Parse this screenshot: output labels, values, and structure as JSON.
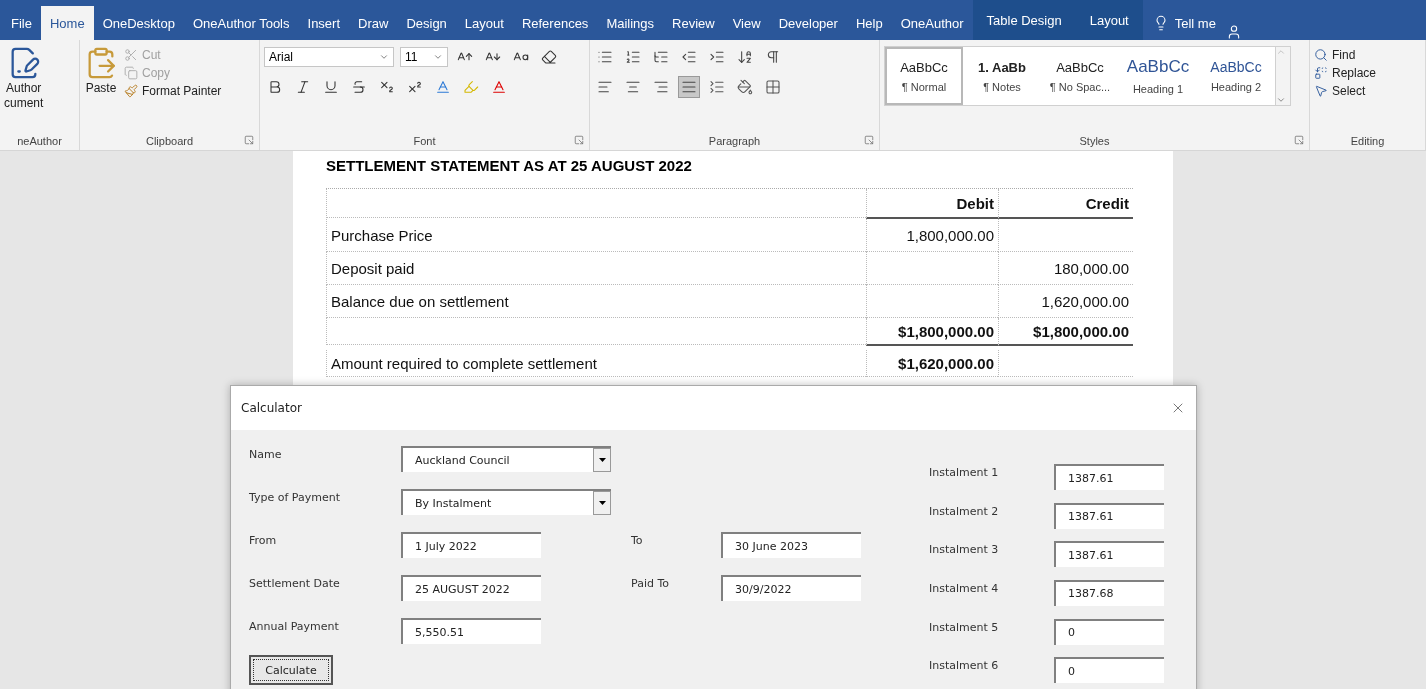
{
  "ribbon_tabs": [
    {
      "label": "File",
      "selected": false,
      "kind": "normal"
    },
    {
      "label": "Home",
      "selected": true,
      "kind": "normal"
    },
    {
      "label": "OneDesktop",
      "selected": false,
      "kind": "normal"
    },
    {
      "label": "OneAuthor Tools",
      "selected": false,
      "kind": "normal"
    },
    {
      "label": "Insert",
      "selected": false,
      "kind": "normal"
    },
    {
      "label": "Draw",
      "selected": false,
      "kind": "normal"
    },
    {
      "label": "Design",
      "selected": false,
      "kind": "normal"
    },
    {
      "label": "Layout",
      "selected": false,
      "kind": "normal"
    },
    {
      "label": "References",
      "selected": false,
      "kind": "normal"
    },
    {
      "label": "Mailings",
      "selected": false,
      "kind": "normal"
    },
    {
      "label": "Review",
      "selected": false,
      "kind": "normal"
    },
    {
      "label": "View",
      "selected": false,
      "kind": "normal"
    },
    {
      "label": "Developer",
      "selected": false,
      "kind": "normal"
    },
    {
      "label": "Help",
      "selected": false,
      "kind": "normal"
    },
    {
      "label": "OneAuthor",
      "selected": false,
      "kind": "normal"
    },
    {
      "label": "Table Design",
      "selected": false,
      "kind": "contextual"
    },
    {
      "label": "Layout",
      "selected": false,
      "kind": "contextual"
    }
  ],
  "tell_me": "Tell me",
  "one_author": {
    "label": "neAuthor",
    "button_lines": [
      "Author",
      "cument"
    ]
  },
  "clipboard": {
    "label": "Clipboard",
    "paste": "Paste",
    "items": [
      {
        "label": "Cut",
        "disabled": true
      },
      {
        "label": "Copy",
        "disabled": true
      },
      {
        "label": "Format Painter",
        "disabled": false
      }
    ]
  },
  "font": {
    "label": "Font",
    "font_name": "Arial",
    "font_size": "11"
  },
  "paragraph": {
    "label": "Paragraph",
    "alignments": [
      {
        "selected": false
      },
      {
        "selected": false
      },
      {
        "selected": false
      },
      {
        "selected": true
      }
    ]
  },
  "styles": {
    "label": "Styles",
    "items": [
      {
        "preview": "AaBbCc",
        "name": "¶ Normal",
        "selected": true,
        "kind": "body"
      },
      {
        "preview": "1. AaBb",
        "name": "¶ Notes",
        "selected": false,
        "kind": "bold"
      },
      {
        "preview": "AaBbCc",
        "name": "¶ No Spac...",
        "selected": false,
        "kind": "body"
      },
      {
        "preview": "AaBbCc",
        "name": "Heading 1",
        "selected": false,
        "kind": "heading1"
      },
      {
        "preview": "AaBbCc",
        "name": "Heading 2",
        "selected": false,
        "kind": "heading2"
      }
    ]
  },
  "editing": {
    "label": "Editing",
    "items": [
      "Find",
      "Replace",
      "Select"
    ]
  },
  "document": {
    "title": "SETTLEMENT STATEMENT AS AT 25 AUGUST 2022",
    "rows": [
      {
        "kind": "header",
        "label": "",
        "debit": "Debit",
        "credit": "Credit"
      },
      {
        "kind": "plain",
        "label": "Purchase Price",
        "debit": "1,800,000.00",
        "credit": ""
      },
      {
        "kind": "plain",
        "label": "Deposit paid",
        "debit": "",
        "credit": "180,000.00"
      },
      {
        "kind": "plain",
        "label": "Balance due on settlement",
        "debit": "",
        "credit": "1,620,000.00"
      },
      {
        "kind": "total",
        "label": "",
        "debit": "$1,800,000.00",
        "credit": "$1,800,000.00"
      },
      {
        "kind": "result",
        "label": "Amount required to complete settlement",
        "debit": "$1,620,000.00",
        "credit": ""
      }
    ]
  },
  "calculator": {
    "title": "Calculator",
    "fields": [
      {
        "label": "Name",
        "value": "Auckland Council",
        "kind": "combo"
      },
      {
        "label": "Type of Payment",
        "value": "By Instalment",
        "kind": "combo"
      },
      {
        "label": "From",
        "value": "1 July 2022",
        "kind": "text",
        "pair_label": "To",
        "pair_value": "30 June 2023"
      },
      {
        "label": "Settlement Date",
        "value": "25 AUGUST 2022",
        "kind": "text",
        "pair_label": "Paid To",
        "pair_value": "30/9/2022"
      },
      {
        "label": "Annual Payment",
        "value": "5,550.51",
        "kind": "text"
      }
    ],
    "instalments": [
      {
        "label": "Instalment 1",
        "value": "1387.61"
      },
      {
        "label": "Instalment 2",
        "value": "1387.61"
      },
      {
        "label": "Instalment 3",
        "value": "1387.61"
      },
      {
        "label": "Instalment 4",
        "value": "1387.68"
      },
      {
        "label": "Instalment 5",
        "value": "0"
      },
      {
        "label": "Instalment 6",
        "value": "0"
      }
    ],
    "button": "Calculate"
  }
}
